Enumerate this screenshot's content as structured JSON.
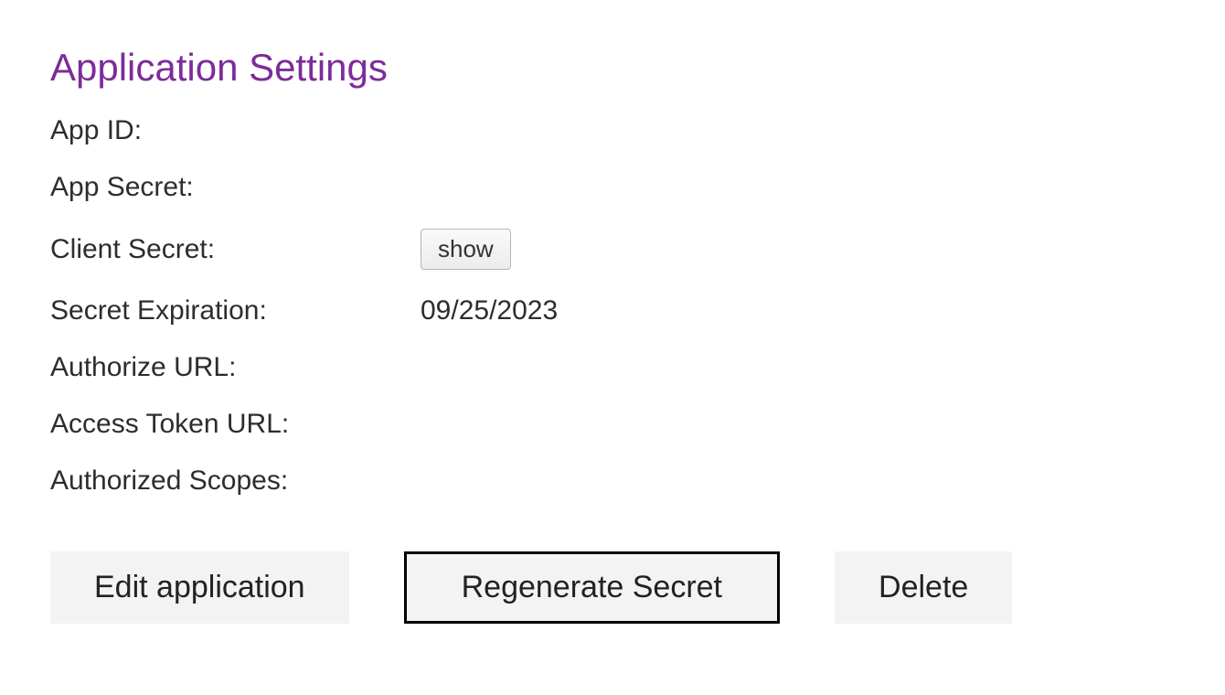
{
  "title": "Application Settings",
  "fields": {
    "app_id": {
      "label": "App ID:",
      "value": ""
    },
    "app_secret": {
      "label": "App Secret:",
      "value": ""
    },
    "client_secret": {
      "label": "Client Secret:",
      "show_label": "show"
    },
    "secret_expiration": {
      "label": "Secret Expiration:",
      "value": "09/25/2023"
    },
    "authorize_url": {
      "label": "Authorize URL:",
      "value": ""
    },
    "access_token_url": {
      "label": "Access Token URL:",
      "value": ""
    },
    "authorized_scopes": {
      "label": "Authorized Scopes:",
      "value": ""
    }
  },
  "actions": {
    "edit": "Edit application",
    "regenerate": "Regenerate Secret",
    "delete": "Delete"
  }
}
